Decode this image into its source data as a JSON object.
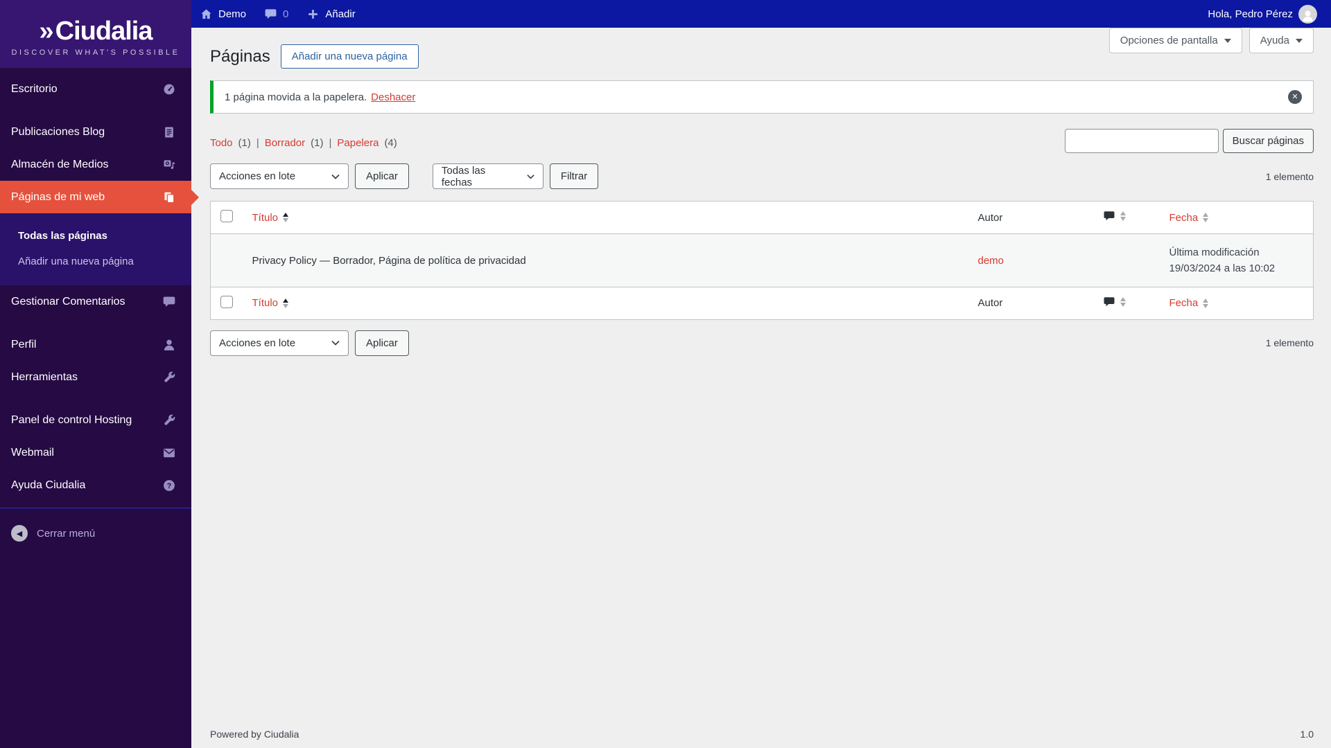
{
  "colors": {
    "top_bar_blue": "#0c18a2",
    "sidebar_purple": "#250a44",
    "sidebar_logo_purple": "#371671",
    "submenu_indigo": "#2a1169",
    "active_orange": "#e5513c",
    "link_red": "#d63a30",
    "notice_green": "#00a32a"
  },
  "admin_bar": {
    "site_name": "Demo",
    "comment_count": "0",
    "add_new_label": "Añadir",
    "greeting": "Hola, Pedro Pérez"
  },
  "sidebar": {
    "logo_mark": "»",
    "logo_name": "Ciudalia",
    "logo_tagline": "DISCOVER WHAT'S POSSIBLE",
    "items": [
      {
        "label": "Escritorio"
      },
      {
        "label": "Publicaciones Blog"
      },
      {
        "label": "Almacén de Medios"
      },
      {
        "label": "Páginas de mi web"
      },
      {
        "label": "Gestionar Comentarios"
      },
      {
        "label": "Perfil"
      },
      {
        "label": "Herramientas"
      },
      {
        "label": "Panel de control Hosting"
      },
      {
        "label": "Webmail"
      },
      {
        "label": "Ayuda Ciudalia"
      }
    ],
    "submenu": [
      {
        "label": "Todas las páginas"
      },
      {
        "label": "Añadir una nueva página"
      }
    ],
    "collapse_label": "Cerrar menú"
  },
  "screen_meta": {
    "screen_options_label": "Opciones de pantalla",
    "help_label": "Ayuda"
  },
  "page": {
    "title": "Páginas",
    "add_new_label": "Añadir una nueva página"
  },
  "notice": {
    "message": "1 página movida a la papelera.",
    "undo_label": "Deshacer"
  },
  "views": {
    "items": [
      {
        "label": "Todo",
        "count": "(1)"
      },
      {
        "label": "Borrador",
        "count": "(1)"
      },
      {
        "label": "Papelera",
        "count": "(4)"
      }
    ],
    "separator": "|"
  },
  "search": {
    "value": "",
    "placeholder": "",
    "button_label": "Buscar páginas"
  },
  "tablenav": {
    "bulk_select_label": "Acciones en lote",
    "apply_label": "Aplicar",
    "date_select_label": "Todas las fechas",
    "filter_label": "Filtrar",
    "count_text": "1 elemento"
  },
  "table": {
    "columns": {
      "title": "Título",
      "author": "Autor",
      "date": "Fecha"
    },
    "rows": [
      {
        "title": "Privacy Policy — Borrador, Página de política de privacidad",
        "author": "demo",
        "date_line1": "Última modificación",
        "date_line2": "19/03/2024 a las 10:02"
      }
    ]
  },
  "footer": {
    "powered_by": "Powered by Ciudalia",
    "version": "1.0"
  }
}
